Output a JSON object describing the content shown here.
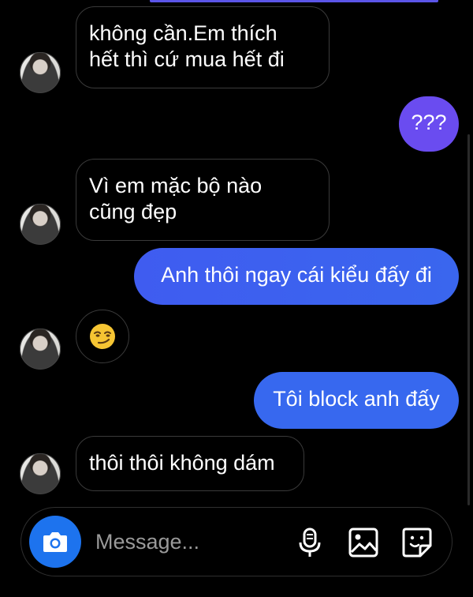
{
  "conversation": {
    "messages": [
      {
        "direction": "received",
        "text": "không cần.Em thích\nhết thì cứ mua hết đi"
      },
      {
        "direction": "sent",
        "text": "???"
      },
      {
        "direction": "received",
        "text": "Vì em mặc bộ nào\ncũng đẹp"
      },
      {
        "direction": "sent",
        "text": "Anh thôi ngay cái kiểu đấy đi"
      },
      {
        "direction": "received",
        "text": "",
        "emoji": "smirking-face-emoji"
      },
      {
        "direction": "sent",
        "text": "Tôi block anh đấy"
      },
      {
        "direction": "received",
        "text": "thôi thôi không dám"
      }
    ]
  },
  "composer": {
    "placeholder": "Message...",
    "icons": [
      "camera-icon",
      "microphone-icon",
      "gallery-icon",
      "sticker-icon"
    ]
  },
  "colors": {
    "background": "#000000",
    "sent_bubble_blue": "#3a66ee",
    "sent_bubble_purple": "#6a4cf0",
    "camera_button": "#1d73ee",
    "received_border": "#3a3a3a"
  }
}
